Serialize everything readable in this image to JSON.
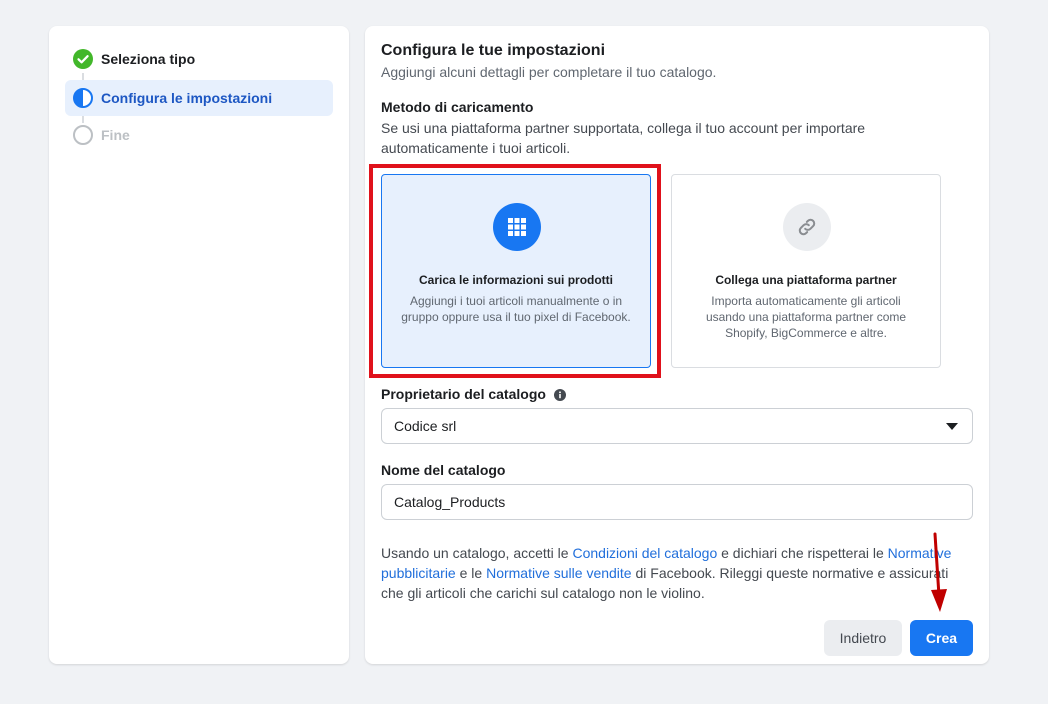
{
  "steps": [
    {
      "label": "Seleziona tipo",
      "state": "done"
    },
    {
      "label": "Configura le impostazioni",
      "state": "current"
    },
    {
      "label": "Fine",
      "state": "pending"
    }
  ],
  "main": {
    "title": "Configura le tue impostazioni",
    "subtitle": "Aggiungi alcuni dettagli per completare il tuo catalogo.",
    "upload_method": {
      "heading": "Metodo di caricamento",
      "description": "Se usi una piattaforma partner supportata, collega il tuo account per importare automaticamente i tuoi articoli.",
      "options": [
        {
          "title": "Carica le informazioni sui prodotti",
          "description": "Aggiungi i tuoi articoli manualmente o in gruppo oppure usa il tuo pixel di Facebook.",
          "icon": "grid-icon",
          "selected": true
        },
        {
          "title": "Collega una piattaforma partner",
          "description": "Importa automaticamente gli articoli usando una piattaforma partner come Shopify, BigCommerce e altre.",
          "icon": "link-icon",
          "selected": false
        }
      ]
    },
    "owner": {
      "label": "Proprietario del catalogo",
      "value": "Codice srl"
    },
    "name": {
      "label": "Nome del catalogo",
      "value": "Catalog_Products"
    },
    "terms": {
      "t1": "Usando un catalogo, accetti le ",
      "link1": "Condizioni del catalogo",
      "t2": " e dichiari che rispetterai le ",
      "link2": "Normative pubblicitarie",
      "t3": " e le ",
      "link3": "Normative sulle vendite",
      "t4": " di Facebook. Rileggi queste normative e assicurati che gli articoli che carichi sul catalogo non le violino."
    },
    "buttons": {
      "back": "Indietro",
      "create": "Crea"
    }
  },
  "colors": {
    "accent": "#1877f2",
    "highlight": "#e0111b",
    "annotation_arrow": "#c00000",
    "done_green": "#42b72a"
  }
}
